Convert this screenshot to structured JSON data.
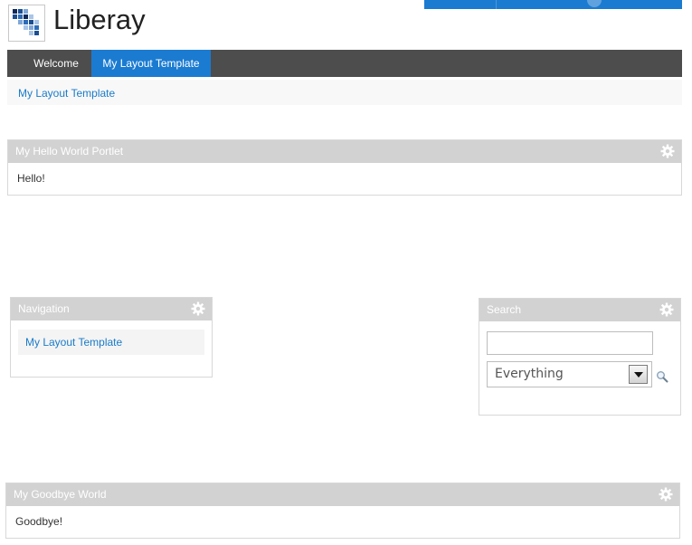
{
  "brand": {
    "name": "Liberay"
  },
  "nav": {
    "items": [
      {
        "label": "Welcome"
      },
      {
        "label": "My Layout Template"
      }
    ]
  },
  "breadcrumb": {
    "current": "My Layout Template"
  },
  "portlets": {
    "hello": {
      "title": "My Hello World Portlet",
      "body": "Hello!"
    },
    "navigation": {
      "title": "Navigation",
      "link": "My Layout Template"
    },
    "search": {
      "title": "Search",
      "input_value": "",
      "select_value": "Everything"
    },
    "goodbye": {
      "title": "My Goodbye World",
      "body": "Goodbye!"
    }
  },
  "icons": {
    "portlet_options": "gear-icon",
    "search_button": "magnifier-icon"
  },
  "colors": {
    "accent": "#1b7bd1",
    "nav_bg": "#4d4d4d",
    "portlet_header": "#d2d2d2",
    "link": "#1a7bc9"
  }
}
